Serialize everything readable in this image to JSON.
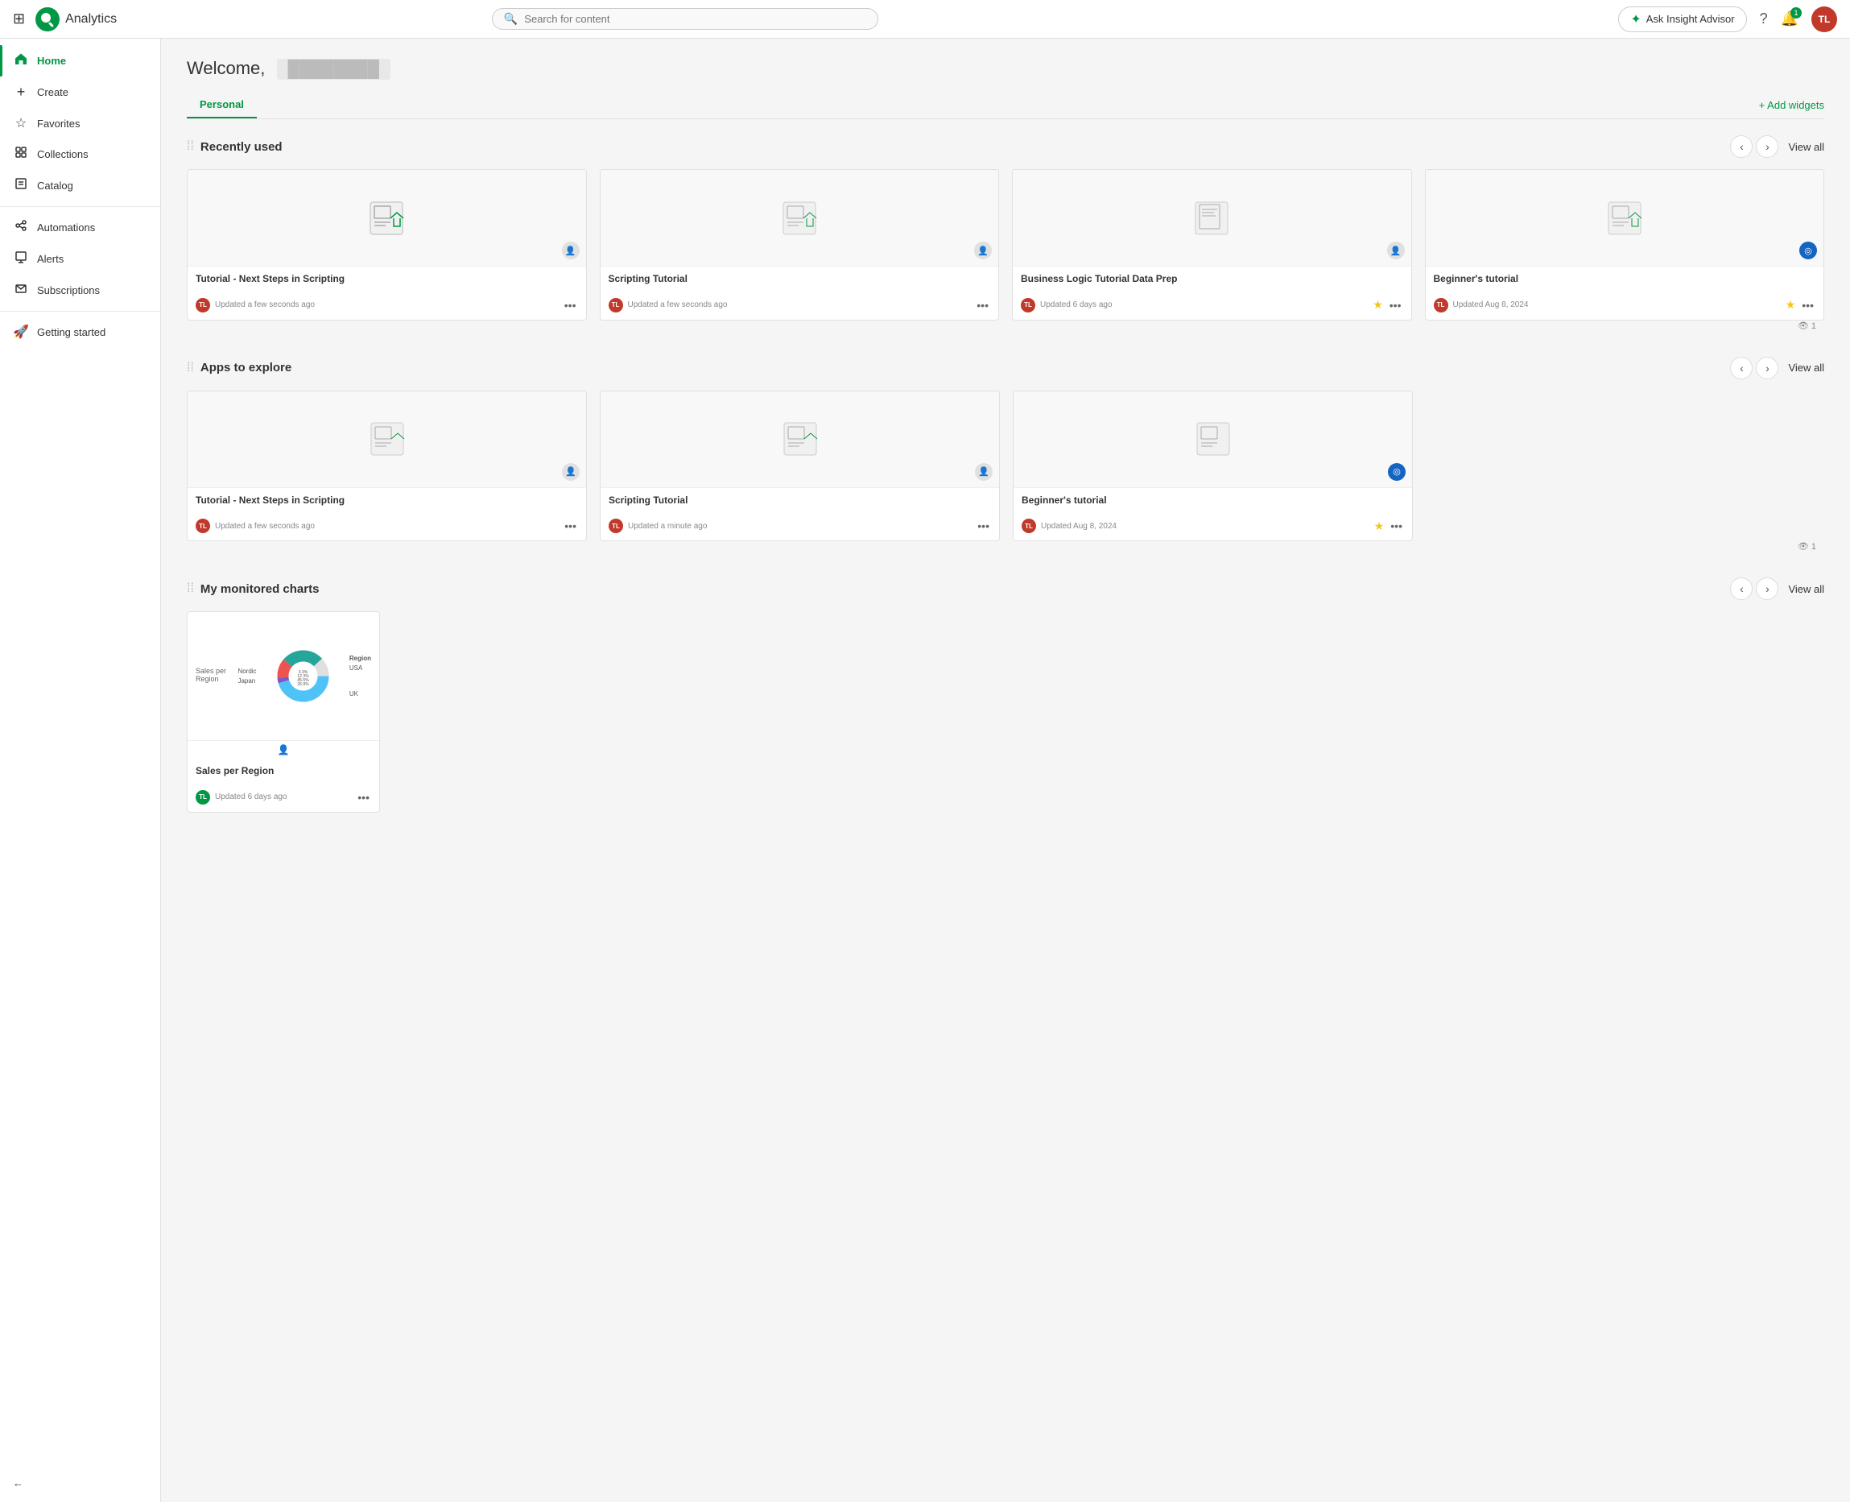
{
  "topnav": {
    "app_name": "Analytics",
    "search_placeholder": "Search for content",
    "insight_label": "Ask Insight Advisor",
    "notification_count": "1",
    "avatar_initials": "TL"
  },
  "sidebar": {
    "items": [
      {
        "id": "home",
        "label": "Home",
        "icon": "⊞",
        "active": true
      },
      {
        "id": "create",
        "label": "Create",
        "icon": "+",
        "active": false
      },
      {
        "id": "favorites",
        "label": "Favorites",
        "icon": "☆",
        "active": false
      },
      {
        "id": "collections",
        "label": "Collections",
        "icon": "⊡",
        "active": false
      },
      {
        "id": "catalog",
        "label": "Catalog",
        "icon": "⊟",
        "active": false
      },
      {
        "id": "automations",
        "label": "Automations",
        "icon": "⧉",
        "active": false
      },
      {
        "id": "alerts",
        "label": "Alerts",
        "icon": "▣",
        "active": false
      },
      {
        "id": "subscriptions",
        "label": "Subscriptions",
        "icon": "✉",
        "active": false
      },
      {
        "id": "getting-started",
        "label": "Getting started",
        "icon": "🚀",
        "active": false
      }
    ],
    "collapse_label": "←"
  },
  "main": {
    "welcome_text": "Welcome,",
    "welcome_name": "████████",
    "tabs": [
      {
        "id": "personal",
        "label": "Personal",
        "active": true
      }
    ],
    "add_widgets_label": "+ Add widgets",
    "sections": [
      {
        "id": "recently-used",
        "title": "Recently used",
        "view_all": "View all",
        "cards": [
          {
            "title": "Tutorial - Next Steps in Scripting",
            "meta": "Updated a few seconds ago",
            "starred": false,
            "badge_type": "grey",
            "avatar": "TL"
          },
          {
            "title": "Scripting Tutorial",
            "meta": "Updated a few seconds ago",
            "starred": false,
            "badge_type": "grey",
            "avatar": "TL"
          },
          {
            "title": "Business Logic Tutorial Data Prep",
            "meta": "Updated 6 days ago",
            "starred": true,
            "badge_type": "grey",
            "avatar": "TL"
          },
          {
            "title": "Beginner's tutorial",
            "meta": "Updated Aug 8, 2024",
            "starred": true,
            "badge_type": "blue",
            "avatar": "TL"
          }
        ],
        "views_count": "1"
      },
      {
        "id": "apps-to-explore",
        "title": "Apps to explore",
        "view_all": "View all",
        "cards": [
          {
            "title": "Tutorial - Next Steps in Scripting",
            "meta": "Updated a few seconds ago",
            "starred": false,
            "badge_type": "grey",
            "avatar": "TL"
          },
          {
            "title": "Scripting Tutorial",
            "meta": "Updated a minute ago",
            "starred": false,
            "badge_type": "grey",
            "avatar": "TL"
          },
          {
            "title": "Beginner's tutorial",
            "meta": "Updated Aug 8, 2024",
            "starred": true,
            "badge_type": "blue",
            "avatar": "TL"
          }
        ],
        "views_count": "1"
      },
      {
        "id": "my-monitored-charts",
        "title": "My monitored charts",
        "view_all": "View all",
        "chart_card": {
          "title": "Sales per Region",
          "meta": "Updated 6 days ago",
          "avatar": "TL",
          "chart_title": "Sales per Region",
          "legend_label": "Region",
          "segments": [
            {
              "label": "USA",
              "value": "45.5%",
              "color": "#4fc3f7"
            },
            {
              "label": "Nordic",
              "value": "3.3%",
              "color": "#7e57c2"
            },
            {
              "label": "Japan",
              "value": "12.3%",
              "color": "#ef5350"
            },
            {
              "label": "UK",
              "value": "26.9%",
              "color": "#26a69a"
            }
          ]
        }
      }
    ]
  }
}
